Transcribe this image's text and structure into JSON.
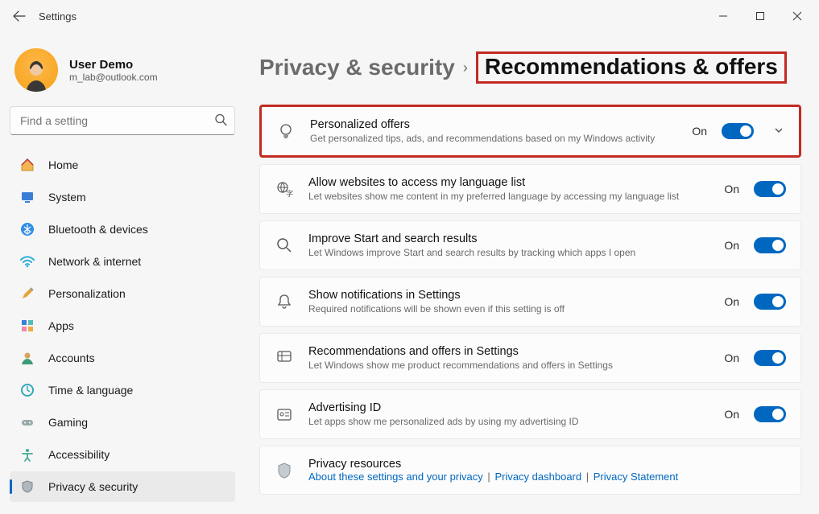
{
  "titlebar": {
    "title": "Settings"
  },
  "user": {
    "name": "User Demo",
    "email": "m_lab@outlook.com"
  },
  "search": {
    "placeholder": "Find a setting"
  },
  "sidebar": {
    "items": [
      {
        "label": "Home"
      },
      {
        "label": "System"
      },
      {
        "label": "Bluetooth & devices"
      },
      {
        "label": "Network & internet"
      },
      {
        "label": "Personalization"
      },
      {
        "label": "Apps"
      },
      {
        "label": "Accounts"
      },
      {
        "label": "Time & language"
      },
      {
        "label": "Gaming"
      },
      {
        "label": "Accessibility"
      },
      {
        "label": "Privacy & security"
      }
    ]
  },
  "breadcrumb": {
    "parent": "Privacy & security",
    "current": "Recommendations & offers"
  },
  "cards": [
    {
      "title": "Personalized offers",
      "desc": "Get personalized tips, ads, and recommendations based on my Windows activity",
      "state": "On"
    },
    {
      "title": "Allow websites to access my language list",
      "desc": "Let websites show me content in my preferred language by accessing my language list",
      "state": "On"
    },
    {
      "title": "Improve Start and search results",
      "desc": "Let Windows improve Start and search results by tracking which apps I open",
      "state": "On"
    },
    {
      "title": "Show notifications in Settings",
      "desc": "Required notifications will be shown even if this setting is off",
      "state": "On"
    },
    {
      "title": "Recommendations and offers in Settings",
      "desc": "Let Windows show me product recommendations and offers in Settings",
      "state": "On"
    },
    {
      "title": "Advertising ID",
      "desc": "Let apps show me personalized ads by using my advertising ID",
      "state": "On"
    }
  ],
  "resources": {
    "title": "Privacy resources",
    "links": [
      "About these settings and your privacy",
      "Privacy dashboard",
      "Privacy Statement"
    ],
    "sep": "|"
  }
}
